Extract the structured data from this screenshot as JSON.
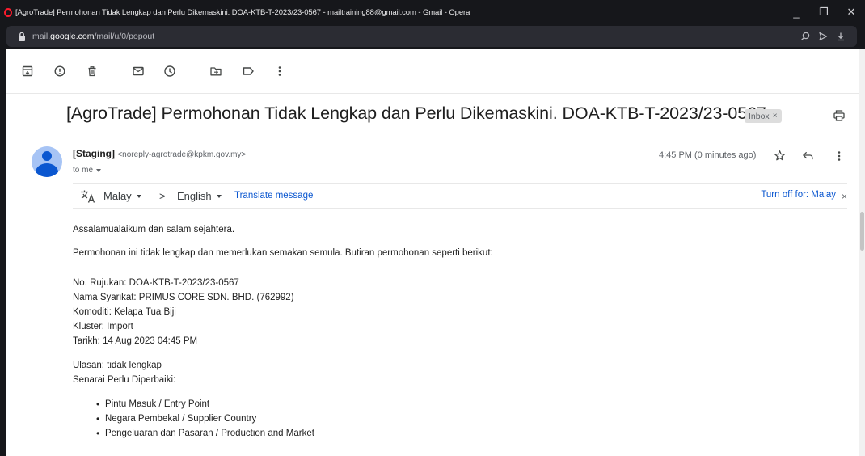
{
  "window": {
    "title": "[AgroTrade] Permohonan Tidak Lengkap dan Perlu Dikemaskini. DOA-KTB-T-2023/23-0567 - mailtraining88@gmail.com - Gmail - Opera",
    "minimize_glyph": "_",
    "restore_glyph": "❐",
    "close_glyph": "✕"
  },
  "address": {
    "prefix": "mail.",
    "domain": "google.com",
    "path": "/mail/u/0/popout"
  },
  "toolbar": {
    "icons": [
      "archive-icon",
      "report-spam-icon",
      "delete-icon",
      "mark-unread-icon",
      "snooze-icon",
      "move-to-icon",
      "label-icon",
      "more-options-icon"
    ]
  },
  "email": {
    "subject": "[AgroTrade] Permohonan Tidak Lengkap dan Perlu Dikemaskini. DOA-KTB-T-2023/23-0567",
    "label": "Inbox",
    "label_close": "×",
    "sender_name": "[Staging]",
    "sender_email": "<noreply-agrotrade@kpkm.gov.my>",
    "recipient": "to me",
    "time": "4:45 PM (0 minutes ago)"
  },
  "translate": {
    "from_lang": "Malay",
    "arrow": ">",
    "to_lang": "English",
    "link": "Translate message",
    "turn_off": "Turn off for: Malay",
    "close": "×"
  },
  "body": {
    "greeting": "Assalamualaikum dan salam sejahtera.",
    "intro": "Permohonan ini tidak lengkap dan memerlukan semakan semula. Butiran permohonan seperti berikut:",
    "details": [
      "No. Rujukan: DOA-KTB-T-2023/23-0567",
      "Nama Syarikat: PRIMUS CORE SDN. BHD. (762992)",
      "Komoditi: Kelapa Tua Biji",
      "Kluster: Import",
      "Tarikh: 14 Aug 2023 04:45 PM"
    ],
    "remark": "Ulasan: tidak lengkap",
    "fix_heading": "Senarai Perlu Diperbaiki:",
    "fix_items": [
      "Pintu Masuk / Entry Point",
      "Negara Pembekal / Supplier Country",
      "Pengeluaran dan Pasaran / Production and Market"
    ]
  },
  "colors": {
    "browser_dark": "#16171b",
    "link_blue": "#0b57d0",
    "avatar_bg": "#a7c4f5",
    "opera_red": "#ff1b2d"
  }
}
